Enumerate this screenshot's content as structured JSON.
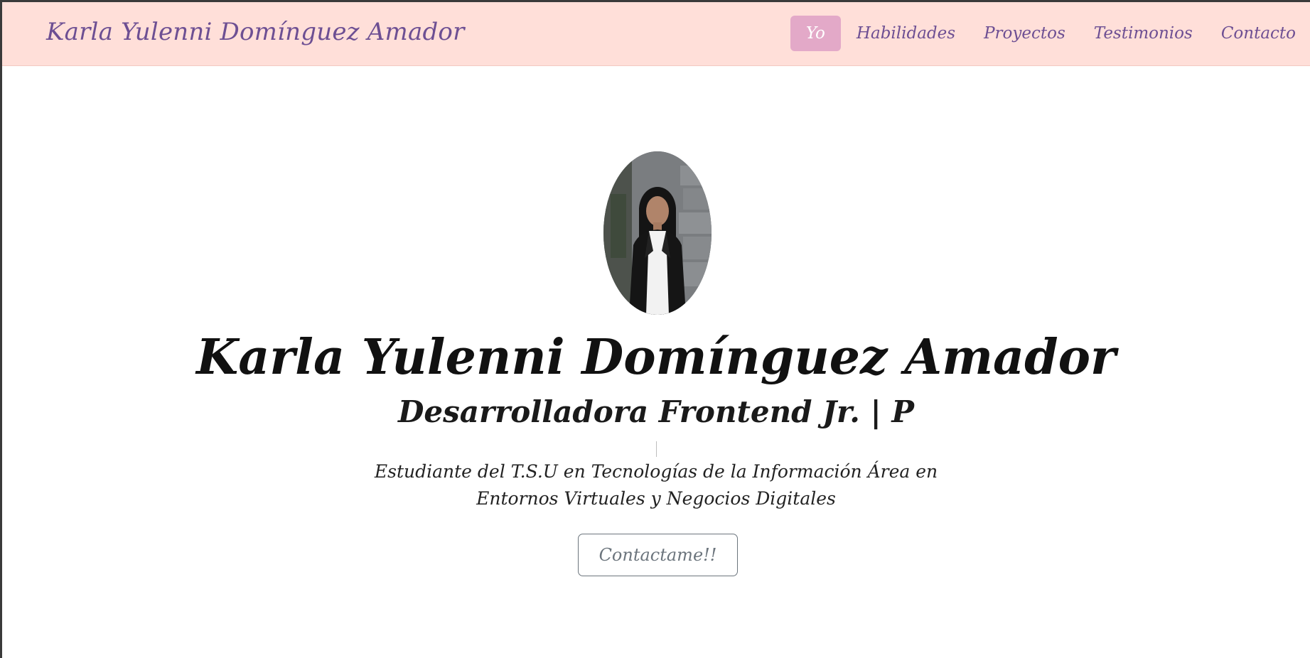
{
  "navbar": {
    "brand": "Karla Yulenni Domínguez Amador",
    "links": [
      {
        "label": "Yo",
        "active": true
      },
      {
        "label": "Habilidades",
        "active": false
      },
      {
        "label": "Proyectos",
        "active": false
      },
      {
        "label": "Testimonios",
        "active": false
      },
      {
        "label": "Contacto",
        "active": false
      }
    ]
  },
  "hero": {
    "name": "Karla Yulenni Domínguez Amador",
    "role": "Desarrolladora Frontend Jr. | P",
    "description": "Estudiante del T.S.U en Tecnologías de la Información Área en Entornos Virtuales y Negocios Digitales",
    "button_label": "Contactame!!"
  },
  "colors": {
    "navbar_bg": "#ffdfd9",
    "nav_text": "#6d4f93",
    "active_tab_bg": "#e3a9c8",
    "button_border": "#6c757d"
  }
}
